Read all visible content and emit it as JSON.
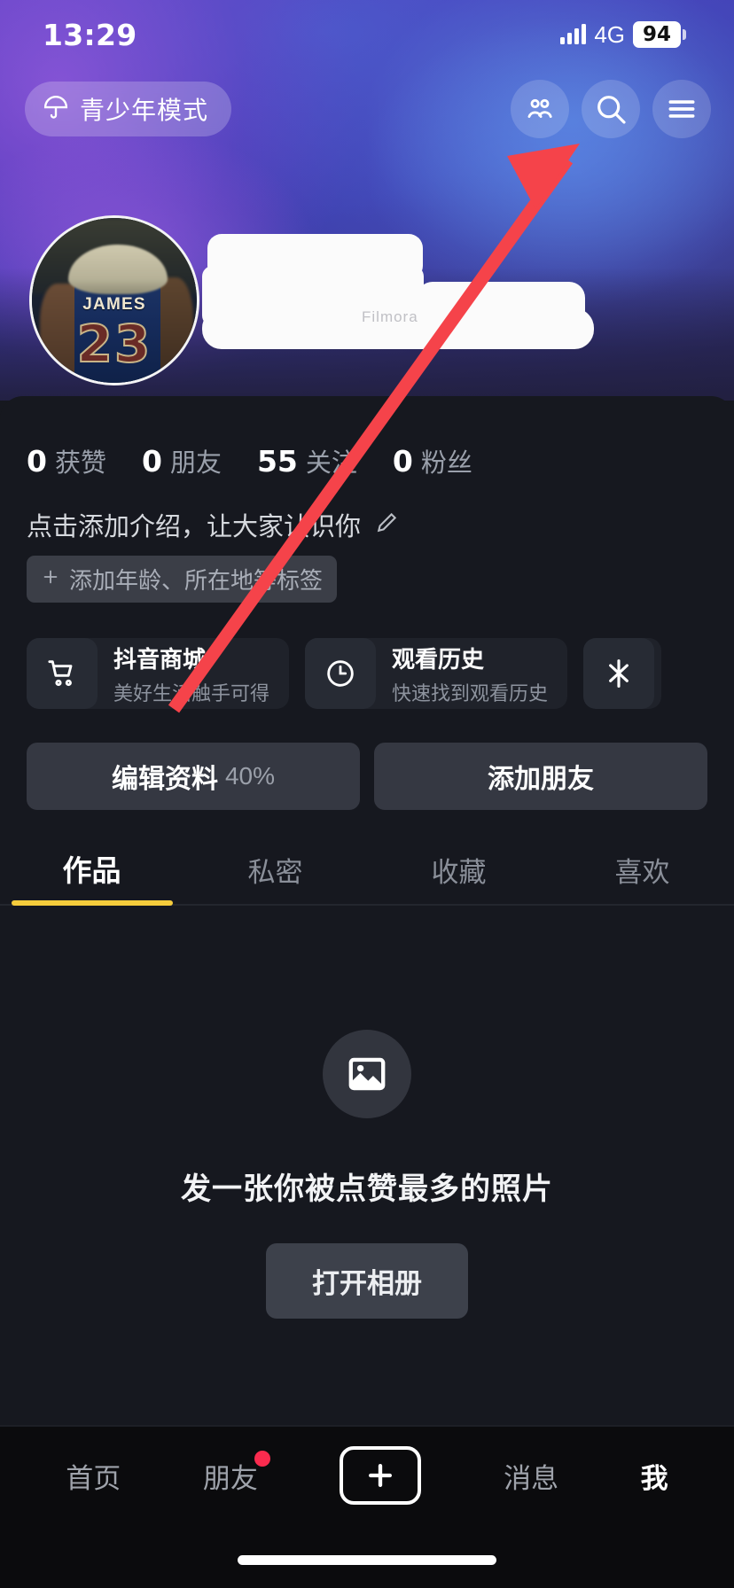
{
  "status_bar": {
    "time": "13:29",
    "network": "4G",
    "battery": "94",
    "signal_icon": "signal-bars-icon",
    "battery_icon": "battery-icon"
  },
  "header": {
    "teen_mode_label": "青少年模式",
    "teen_mode_icon": "umbrella-icon",
    "icons": [
      {
        "name": "friends-icon",
        "label": "发现朋友"
      },
      {
        "name": "search-icon",
        "label": "搜索"
      },
      {
        "name": "menu-icon",
        "label": "更多"
      }
    ],
    "accent_gradient_from": "#5b3fc4",
    "accent_gradient_to": "#2e2c63"
  },
  "profile": {
    "avatar_alt": "JAMES 23",
    "avatar_name_text": "JAMES",
    "avatar_number_text": "23",
    "username_redacted": true,
    "watermark": "Filmora"
  },
  "stats": [
    {
      "num": "0",
      "label": "获赞"
    },
    {
      "num": "0",
      "label": "朋友"
    },
    {
      "num": "55",
      "label": "关注"
    },
    {
      "num": "0",
      "label": "粉丝"
    }
  ],
  "bio": {
    "text": "点击添加介绍，让大家认识你",
    "edit_icon": "pencil-icon",
    "tag_placeholder": "添加年龄、所在地等标签",
    "tag_plus_icon": "plus-icon"
  },
  "service_cards": [
    {
      "title": "抖音商城",
      "subtitle": "美好生活触手可得",
      "icon": "shopping-cart-icon"
    },
    {
      "title": "观看历史",
      "subtitle": "快速找到观看历史",
      "icon": "clock-icon"
    },
    {
      "title": "",
      "subtitle": "",
      "icon": "douyin-logo-icon"
    }
  ],
  "actions": {
    "edit_profile_label": "编辑资料",
    "edit_profile_percent": "40%",
    "add_friend_label": "添加朋友"
  },
  "content_tabs": [
    {
      "label": "作品",
      "active": true
    },
    {
      "label": "私密",
      "active": false
    },
    {
      "label": "收藏",
      "active": false
    },
    {
      "label": "喜欢",
      "active": false
    }
  ],
  "tab_indicator_color": "#f5cc3c",
  "empty_state": {
    "icon": "image-placeholder-icon",
    "title": "发一张你被点赞最多的照片",
    "button_label": "打开相册"
  },
  "bottom_nav": [
    {
      "label": "首页",
      "active": false,
      "badge": false,
      "icon": "home-tab"
    },
    {
      "label": "朋友",
      "active": false,
      "badge": true,
      "icon": "friends-tab"
    },
    {
      "label": "",
      "active": false,
      "badge": false,
      "icon": "plus-create-icon"
    },
    {
      "label": "消息",
      "active": false,
      "badge": false,
      "icon": "messages-tab"
    },
    {
      "label": "我",
      "active": true,
      "badge": false,
      "icon": "profile-tab"
    }
  ],
  "annotation": {
    "arrow_color": "#f5434a",
    "arrow_description": "红色箭头指向右上角菜单按钮"
  }
}
